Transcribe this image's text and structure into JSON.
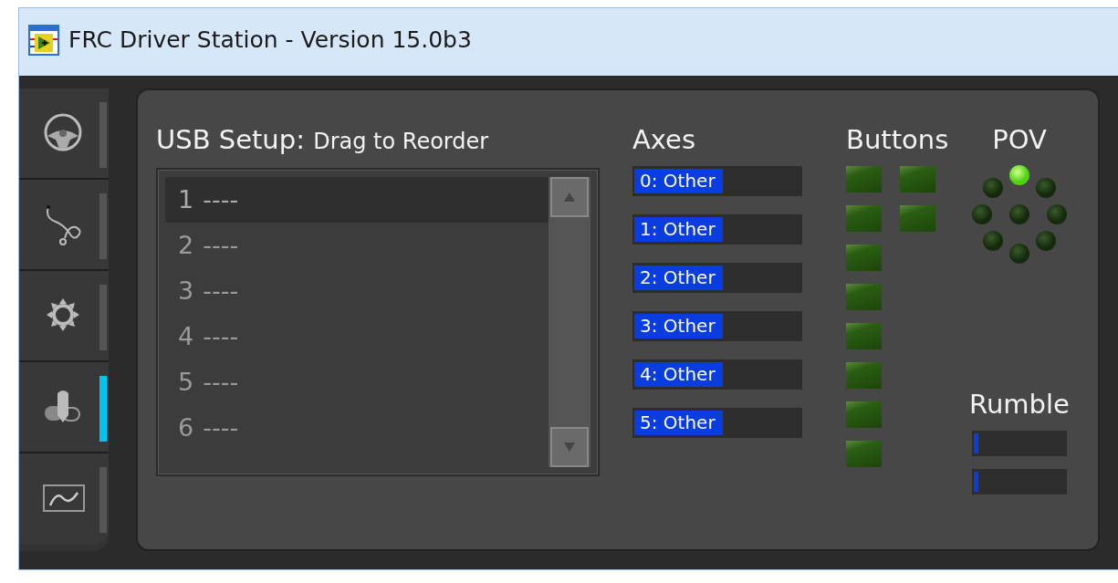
{
  "window": {
    "title": "FRC Driver Station - Version 15.0b3"
  },
  "tabs": [
    {
      "kind": "drive",
      "selected": false
    },
    {
      "kind": "diagnostics",
      "selected": false
    },
    {
      "kind": "setup",
      "selected": false
    },
    {
      "kind": "usb",
      "selected": true
    },
    {
      "kind": "charts",
      "selected": false
    }
  ],
  "usb_setup": {
    "title": "USB Setup:",
    "subtitle": "Drag to Reorder",
    "devices": [
      {
        "number": "1",
        "name": "----",
        "selected": true
      },
      {
        "number": "2",
        "name": "----",
        "selected": false
      },
      {
        "number": "3",
        "name": "----",
        "selected": false
      },
      {
        "number": "4",
        "name": "----",
        "selected": false
      },
      {
        "number": "5",
        "name": "----",
        "selected": false
      },
      {
        "number": "6",
        "name": "----",
        "selected": false
      }
    ]
  },
  "axes": {
    "title": "Axes",
    "items": [
      {
        "label": "0: Other",
        "level": 0.52
      },
      {
        "label": "1: Other",
        "level": 0.52
      },
      {
        "label": "2: Other",
        "level": 0.52
      },
      {
        "label": "3: Other",
        "level": 0.52
      },
      {
        "label": "4: Other",
        "level": 0.52
      },
      {
        "label": "5: Other",
        "level": 0.52
      }
    ]
  },
  "buttons": {
    "title": "Buttons",
    "columns": [
      [
        {
          "pressed": false
        },
        {
          "pressed": false
        },
        {
          "pressed": false
        },
        {
          "pressed": false
        },
        {
          "pressed": false
        },
        {
          "pressed": false
        },
        {
          "pressed": false
        },
        {
          "pressed": false
        }
      ],
      [
        {
          "pressed": false
        },
        {
          "pressed": false
        }
      ]
    ]
  },
  "pov": {
    "title": "POV",
    "directions": [
      {
        "kind": "n",
        "selected": true
      },
      {
        "kind": "ne",
        "selected": false
      },
      {
        "kind": "e",
        "selected": false
      },
      {
        "kind": "se",
        "selected": false
      },
      {
        "kind": "s",
        "selected": false
      },
      {
        "kind": "sw",
        "selected": false
      },
      {
        "kind": "w",
        "selected": false
      },
      {
        "kind": "nw",
        "selected": false
      },
      {
        "kind": "center",
        "selected": false
      }
    ]
  },
  "rumble": {
    "title": "Rumble",
    "items": [
      {
        "level": 0.05
      },
      {
        "level": 0.05
      }
    ]
  }
}
